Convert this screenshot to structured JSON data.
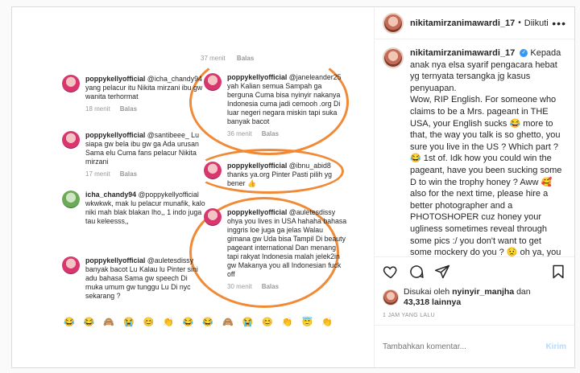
{
  "post": {
    "username": "nikitamirzanimawardi_17",
    "separator": "•",
    "follow_label": "Diikuti",
    "more_label": "•••",
    "caption_lines": [
      "Kepada",
      "anak nya elsa syarif pengacara hebat",
      "yg ternyata tersangka jg kasus",
      "penyuapan.",
      "Wow, RIP English. For someone who",
      "claims to be a Mrs. pageant in THE",
      "USA, your English sucks 😂 more to",
      "that, the way you talk is so ghetto, you",
      "sure you live in the US ? Which part ?",
      "😂 1st of. Idk how you could win the",
      "pageant, have you been sucking some",
      "D to win the trophy honey ? Aww 🥰",
      "also for the next time, please hire a",
      "better photographer and a",
      "PHOTOSHOPER cuz honey your",
      "ugliness sometimes reveal through",
      "some pics :/ you don't want to get",
      "some mockery do you ? 😟 oh ya, you",
      "could ......................................"
    ],
    "likes_prefix": "Disukai oleh",
    "likes_user": "nyinyir_manjha",
    "likes_and": "dan",
    "likes_count": "43,318",
    "likes_suffix": "lainnya",
    "timestamp": "1 JAM YANG LALU",
    "comment_placeholder": "Tambahkan komentar...",
    "send_label": "Kirim"
  },
  "shot": {
    "left": [
      {
        "user": "poppykellyofficial",
        "text": "@icha_chandy94 yang pelacur itu Nikita mirzani ibu gw wanita terhormat",
        "time": "18 menit",
        "reply": "Balas",
        "green": false
      },
      {
        "user": "poppykellyofficial",
        "text": "@santibeee_ Lu siapa gw bela ibu gw ga Ada urusan Sama elu Cuma fans pelacur Nikita mirzani",
        "time": "17 menit",
        "reply": "Balas",
        "green": false
      },
      {
        "user": "icha_chandy94",
        "text": "@poppykellyofficial wkwkwk, mak lu pelacur munafik, kalo niki mah blak blakan lho,, 1 indo juga tau keleesss,,",
        "time": "",
        "reply": "",
        "green": true
      },
      {
        "user": "poppykellyofficial",
        "text": "@auletesdissy banyak bacot Lu Kalau lu Pinter sini adu bahasa Sama gw speech Di muka umum gw tunggu Lu Di nyc sekarang ?",
        "time": "",
        "reply": "",
        "green": false
      }
    ],
    "right": [
      {
        "user": "poppykellyofficial",
        "text": "@janeleander25 yah Kalian semua Sampah ga berguna Cuma bisa nyinyir nakanya Indonesia cuma jadi cemooh .org Di luar negeri negara miskin tapi suka banyak bacot",
        "time": "36 menit",
        "reply": "Balas",
        "green": false
      },
      {
        "user": "poppykellyofficial",
        "text": "@ibnu_abid8 thanks ya.org Pinter Pasti pilih yg bener 👍",
        "time": "",
        "reply": "",
        "green": false
      },
      {
        "user": "poppykellyofficial",
        "text": "@auletesdissy ohya you lives in USA hahaha bahasa inggris loe juga ga jelas Walau gimana gw Uda bisa Tampil Di beauty pageant international Dan menang tapi rakyat Indonesia malah jelek2in gw Makanya you all Indonesian fuck off",
        "time": "30 menit",
        "reply": "Balas",
        "green": false
      }
    ],
    "top_time": "37 menit",
    "top_reply": "Balas",
    "emojis": [
      "😂",
      "😂",
      "🙈",
      "😭",
      "😊",
      "👏",
      "😂",
      "😂",
      "🙈",
      "😭",
      "😊",
      "👏",
      "😇",
      "👏"
    ]
  }
}
